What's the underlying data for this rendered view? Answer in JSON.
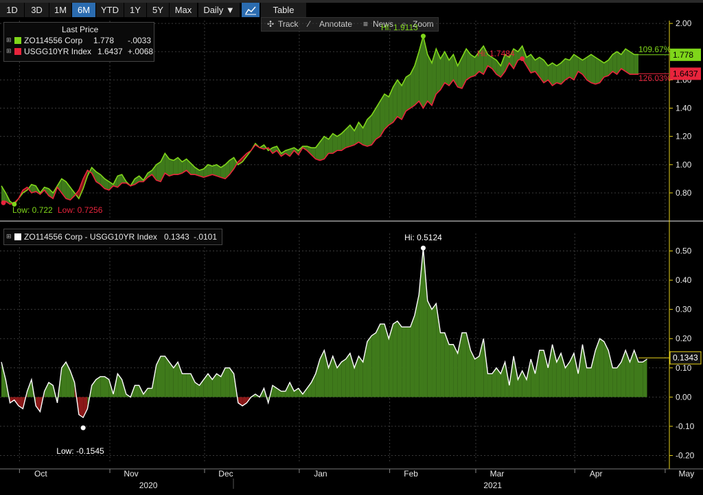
{
  "toolbar": {
    "timeframes": [
      "1D",
      "3D",
      "1M",
      "6M",
      "YTD",
      "1Y",
      "5Y",
      "Max"
    ],
    "active": "6M",
    "period": "Daily ▼",
    "table_label": "Table"
  },
  "toolbar2": {
    "track": "Track",
    "annotate": "Annotate",
    "news": "News",
    "zoom": "Zoom"
  },
  "legend_top": {
    "title": "Last Price",
    "items": [
      {
        "name": "ZO114556 Corp",
        "value": "1.778",
        "change": "-.0033",
        "color": "#7fd61a"
      },
      {
        "name": "USGG10YR Index",
        "value": "1.6437",
        "change": "+.0068",
        "color": "#e8243c"
      }
    ]
  },
  "legend_bottom": {
    "name": "ZO114556 Corp - USGG10YR Index",
    "value": "0.1343",
    "change": "-.0101",
    "color": "#ffffff"
  },
  "colors": {
    "green": "#7fd61a",
    "red": "#e8243c",
    "fill_pos": "#3f7a1b",
    "fill_neg": "#8b1818",
    "grid": "#3a3a3a",
    "axis": "#e8d21a"
  },
  "chart_data": [
    {
      "type": "line",
      "series": [
        {
          "name": "ZO114556 Corp",
          "values": [
            0.85,
            0.8,
            0.74,
            0.72,
            0.76,
            0.8,
            0.82,
            0.86,
            0.85,
            0.8,
            0.84,
            0.83,
            0.8,
            0.85,
            0.9,
            0.88,
            0.84,
            0.8,
            0.76,
            0.83,
            0.92,
            0.98,
            0.95,
            0.93,
            0.9,
            0.88,
            0.86,
            0.92,
            0.93,
            0.88,
            0.85,
            0.9,
            0.92,
            0.89,
            0.94,
            0.96,
            1.0,
            1.02,
            1.08,
            1.04,
            1.03,
            1.05,
            1.02,
            1.04,
            1.01,
            0.98,
            0.96,
            0.97,
            1.0,
            0.99,
            1.0,
            0.98,
            1.0,
            1.03,
            1.05,
            1.0,
            1.02,
            1.06,
            1.1,
            1.15,
            1.12,
            1.14,
            1.1,
            1.12,
            1.13,
            1.08,
            1.1,
            1.11,
            1.12,
            1.1,
            1.13,
            1.13,
            1.12,
            1.12,
            1.16,
            1.2,
            1.18,
            1.22,
            1.2,
            1.22,
            1.25,
            1.28,
            1.24,
            1.3,
            1.26,
            1.32,
            1.35,
            1.4,
            1.45,
            1.5,
            1.48,
            1.55,
            1.6,
            1.56,
            1.62,
            1.64,
            1.7,
            1.8,
            1.91,
            1.78,
            1.72,
            1.82,
            1.75,
            1.8,
            1.74,
            1.78,
            1.7,
            1.76,
            1.82,
            1.78,
            1.76,
            1.8,
            1.84,
            1.78,
            1.76,
            1.74,
            1.7,
            1.78,
            1.76,
            1.82,
            1.8,
            1.84,
            1.76,
            1.78,
            1.74,
            1.76,
            1.74,
            1.7,
            1.72,
            1.7,
            1.72,
            1.75,
            1.74,
            1.78,
            1.76,
            1.74,
            1.76,
            1.78,
            1.76,
            1.74,
            1.72,
            1.74,
            1.78,
            1.8,
            1.78,
            1.82,
            1.8,
            1.78,
            1.78
          ],
          "color": "#7fd61a"
        },
        {
          "name": "USGG10YR Index",
          "values": [
            0.73,
            0.74,
            0.72,
            0.73,
            0.76,
            0.82,
            0.84,
            0.8,
            0.81,
            0.79,
            0.82,
            0.78,
            0.76,
            0.84,
            0.8,
            0.76,
            0.75,
            0.78,
            0.82,
            0.9,
            0.96,
            0.94,
            0.88,
            0.86,
            0.83,
            0.82,
            0.85,
            0.84,
            0.87,
            0.87,
            0.85,
            0.86,
            0.88,
            0.88,
            0.91,
            0.93,
            0.89,
            0.88,
            0.94,
            0.92,
            0.93,
            0.93,
            0.94,
            0.96,
            0.93,
            0.93,
            0.92,
            0.91,
            0.92,
            0.93,
            0.92,
            0.91,
            0.9,
            0.93,
            0.97,
            1.02,
            1.05,
            1.08,
            1.1,
            1.14,
            1.12,
            1.11,
            1.12,
            1.08,
            1.1,
            1.06,
            1.08,
            1.06,
            1.1,
            1.07,
            1.12,
            1.1,
            1.07,
            1.04,
            1.03,
            1.04,
            1.08,
            1.08,
            1.1,
            1.1,
            1.12,
            1.13,
            1.14,
            1.16,
            1.14,
            1.13,
            1.14,
            1.18,
            1.2,
            1.25,
            1.28,
            1.3,
            1.34,
            1.32,
            1.38,
            1.4,
            1.42,
            1.45,
            1.4,
            1.45,
            1.42,
            1.5,
            1.53,
            1.58,
            1.56,
            1.6,
            1.55,
            1.54,
            1.6,
            1.62,
            1.63,
            1.66,
            1.64,
            1.7,
            1.68,
            1.64,
            1.62,
            1.66,
            1.72,
            1.68,
            1.74,
            1.75,
            1.7,
            1.65,
            1.66,
            1.62,
            1.58,
            1.6,
            1.56,
            1.58,
            1.57,
            1.6,
            1.62,
            1.6,
            1.66,
            1.64,
            1.6,
            1.58,
            1.57,
            1.58,
            1.62,
            1.63,
            1.66,
            1.64,
            1.68,
            1.66,
            1.64,
            1.64,
            1.64
          ],
          "color": "#e8243c"
        }
      ],
      "ylim": [
        0.62,
        2.02
      ],
      "yticks": [
        0.8,
        1.0,
        1.2,
        1.4,
        1.6,
        1.8,
        2.0
      ],
      "ytick_labels": [
        "0.80",
        "1.00",
        "1.20",
        "1.40",
        "1.60",
        "1.80",
        "2.00"
      ],
      "annotations": [
        {
          "text": "Low: 0.722",
          "series": 0,
          "index": 3,
          "color": "#7fd61a"
        },
        {
          "text": "Low: 0.7256",
          "series": 1,
          "index": 0,
          "color": "#e8243c"
        },
        {
          "text": "Hi: 1.9113",
          "series": 0,
          "index": 98,
          "color": "#7fd61a"
        },
        {
          "text": "Hi: 1.7484",
          "series": 1,
          "index": 121,
          "color": "#e8243c"
        },
        {
          "text": "109.67%",
          "color": "#7fd61a"
        },
        {
          "text": "126.03%",
          "color": "#e8243c"
        }
      ],
      "last_labels": [
        {
          "text": "1.778",
          "value": 1.778,
          "color": "#7fd61a"
        },
        {
          "text": "1.6437",
          "value": 1.6437,
          "color": "#e8243c"
        }
      ],
      "grid": true
    },
    {
      "type": "area",
      "series": [
        {
          "name": "ZO114556 Corp - USGG10YR Index",
          "values": [
            0.12,
            0.06,
            -0.02,
            -0.01,
            -0.03,
            -0.04,
            0.02,
            0.06,
            -0.03,
            -0.05,
            0.02,
            0.05,
            0.04,
            -0.02,
            0.1,
            0.12,
            0.09,
            0.05,
            -0.06,
            -0.07,
            -0.04,
            0.04,
            0.06,
            0.07,
            0.07,
            0.06,
            0.01,
            0.08,
            0.06,
            0.01,
            0.0,
            0.04,
            0.04,
            0.01,
            0.03,
            0.03,
            0.11,
            0.14,
            0.14,
            0.12,
            0.1,
            0.12,
            0.08,
            0.08,
            0.08,
            0.05,
            0.04,
            0.06,
            0.08,
            0.06,
            0.08,
            0.07,
            0.1,
            0.1,
            0.08,
            -0.02,
            -0.03,
            -0.02,
            0.0,
            0.01,
            0.0,
            0.03,
            -0.02,
            0.04,
            0.03,
            0.02,
            0.02,
            0.05,
            0.02,
            0.03,
            0.01,
            0.03,
            0.05,
            0.08,
            0.13,
            0.16,
            0.1,
            0.14,
            0.1,
            0.12,
            0.13,
            0.15,
            0.1,
            0.14,
            0.12,
            0.19,
            0.21,
            0.22,
            0.25,
            0.25,
            0.2,
            0.25,
            0.26,
            0.24,
            0.24,
            0.24,
            0.28,
            0.35,
            0.51,
            0.33,
            0.3,
            0.32,
            0.22,
            0.22,
            0.18,
            0.18,
            0.15,
            0.22,
            0.22,
            0.16,
            0.13,
            0.14,
            0.2,
            0.08,
            0.08,
            0.1,
            0.08,
            0.12,
            0.04,
            0.14,
            0.06,
            0.09,
            0.06,
            0.13,
            0.08,
            0.16,
            0.16,
            0.1,
            0.18,
            0.12,
            0.15,
            0.1,
            0.12,
            0.15,
            0.08,
            0.18,
            0.1,
            0.1,
            0.16,
            0.2,
            0.19,
            0.16,
            0.1,
            0.1,
            0.12,
            0.16,
            0.12,
            0.16,
            0.12,
            0.12,
            0.13
          ],
          "color": "#ffffff"
        }
      ],
      "ylim": [
        -0.22,
        0.56
      ],
      "yticks": [
        -0.2,
        -0.1,
        0.0,
        0.1,
        0.2,
        0.3,
        0.4,
        0.5
      ],
      "ytick_labels": [
        "-0.20",
        "-0.10",
        "0.00",
        "0.10",
        "0.20",
        "0.30",
        "0.40",
        "0.50"
      ],
      "annotations": [
        {
          "text": "Hi: 0.5124",
          "index": 98
        },
        {
          "text": "Low: -0.1545",
          "index": 19
        }
      ],
      "last_label": {
        "text": "0.1343",
        "value": 0.1343
      },
      "grid": true
    }
  ],
  "x_axis": {
    "months": [
      {
        "label": "Oct",
        "index": 5
      },
      {
        "label": "Nov",
        "index": 26
      },
      {
        "label": "Dec",
        "index": 48
      },
      {
        "label": "Jan",
        "index": 70
      },
      {
        "label": "Feb",
        "index": 91
      },
      {
        "label": "Mar",
        "index": 111
      },
      {
        "label": "Apr",
        "index": 134
      },
      {
        "label": "May",
        "index": 155
      }
    ],
    "years": [
      {
        "label": "2020",
        "index": 30
      },
      {
        "label": "2021",
        "index": 110
      }
    ]
  }
}
